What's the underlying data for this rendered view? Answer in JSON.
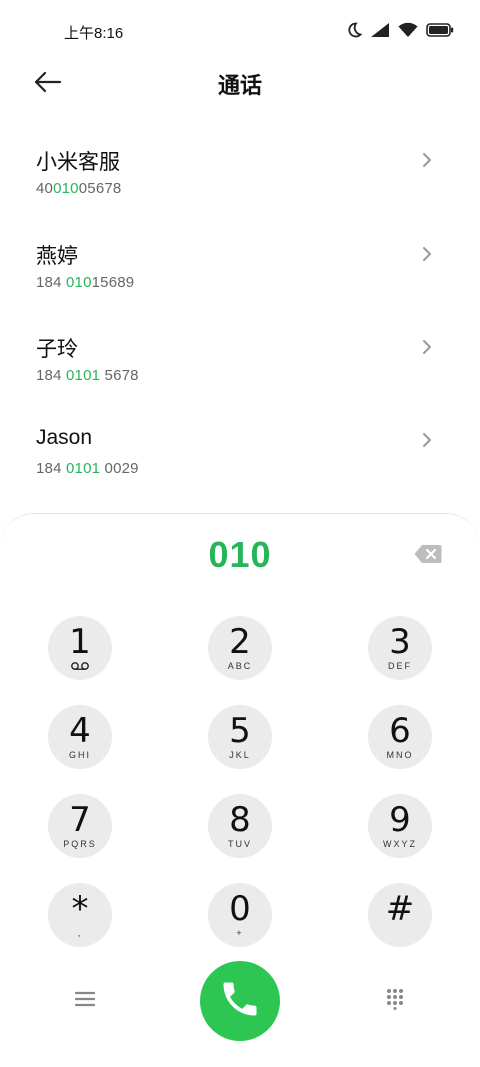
{
  "status_bar": {
    "time": "上午8:16"
  },
  "header": {
    "title": "通话"
  },
  "contacts": [
    {
      "name": "小米客服",
      "number_pre": "40",
      "number_match": "010",
      "number_post": "05678"
    },
    {
      "name": "燕婷",
      "number_pre": "184 ",
      "number_match": "010",
      "number_post": "15689"
    },
    {
      "name": "子玲",
      "number_pre": "184 ",
      "number_match": "0101",
      "number_post": " 5678"
    },
    {
      "name": "Jason",
      "number_pre": "184 ",
      "number_match": "0101",
      "number_post": " 0029"
    }
  ],
  "dialpad": {
    "dialed": "010",
    "keys": [
      {
        "digit": "1",
        "letters": ""
      },
      {
        "digit": "2",
        "letters": "ABC"
      },
      {
        "digit": "3",
        "letters": "DEF"
      },
      {
        "digit": "4",
        "letters": "GHI"
      },
      {
        "digit": "5",
        "letters": "JKL"
      },
      {
        "digit": "6",
        "letters": "MNO"
      },
      {
        "digit": "7",
        "letters": "PQRS"
      },
      {
        "digit": "8",
        "letters": "TUV"
      },
      {
        "digit": "9",
        "letters": "WXYZ"
      },
      {
        "digit": "*",
        "letters": ","
      },
      {
        "digit": "0",
        "letters": "+"
      },
      {
        "digit": "#",
        "letters": ""
      }
    ]
  },
  "colors": {
    "accent": "#27b559",
    "call_button": "#2dc653",
    "key_bg": "#ebebeb"
  }
}
